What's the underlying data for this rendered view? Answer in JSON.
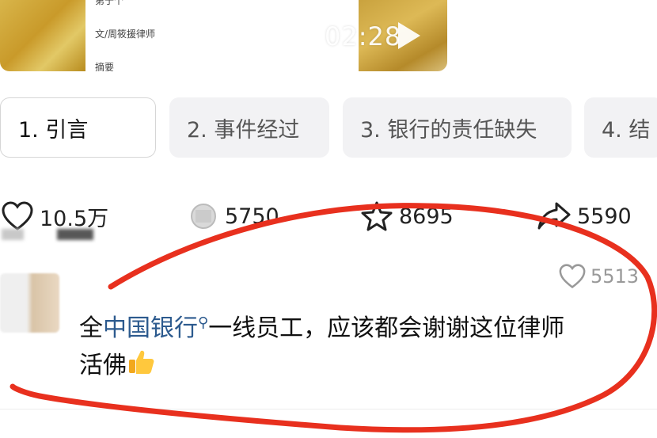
{
  "video_card": {
    "article_top": "第于个",
    "article_author": "文/周筱援律师",
    "article_abstract": "摘要",
    "timestamp": "02:28",
    "play_icon": "play-icon"
  },
  "tabs": [
    {
      "label": "1. 引言",
      "active": true
    },
    {
      "label": "2. 事件经过",
      "active": false
    },
    {
      "label": "3. 银行的责任缺失",
      "active": false
    },
    {
      "label": "4. 结",
      "active": false
    }
  ],
  "stats": {
    "likes": "10.5万",
    "comments": "5750",
    "favorites": "8695",
    "shares": "5590"
  },
  "comment": {
    "likes": "5513",
    "text_prefix": "全",
    "link_text": "中国银行",
    "text_main": "一线员工，应该都会谢谢这位律师",
    "text_line2": "活佛",
    "emoji": "thumbs-up-icon"
  },
  "colors": {
    "annotation": "#e8301e",
    "link": "#2c5a8e",
    "tab_inactive": "#f2f2f4"
  }
}
